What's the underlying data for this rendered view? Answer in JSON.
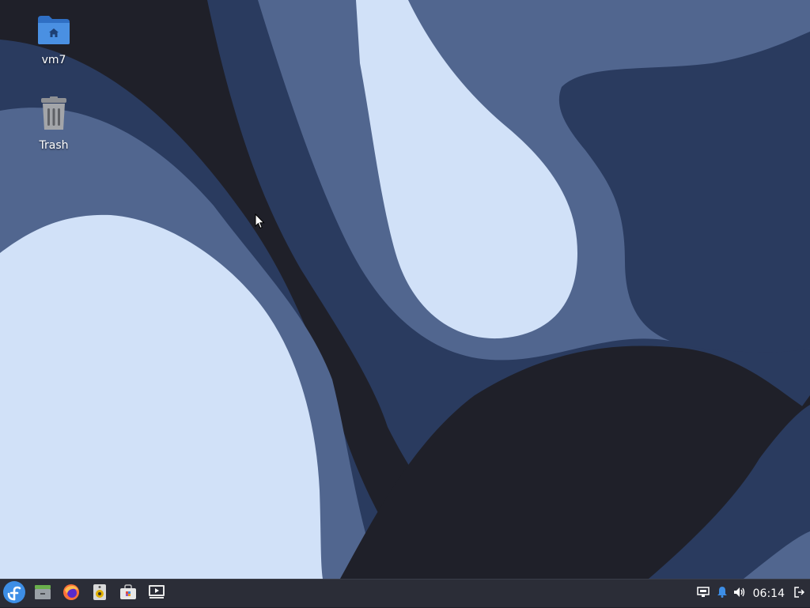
{
  "desktop": {
    "icons": [
      {
        "label": "vm7",
        "icon": "home-folder-icon"
      },
      {
        "label": "Trash",
        "icon": "trash-icon"
      }
    ]
  },
  "taskbar": {
    "launchers": [
      {
        "name": "start-menu",
        "icon": "fedora-logo-icon"
      },
      {
        "name": "file-manager",
        "icon": "file-cabinet-icon"
      },
      {
        "name": "firefox",
        "icon": "firefox-icon"
      },
      {
        "name": "audio-player",
        "icon": "speaker-app-icon"
      },
      {
        "name": "software-center",
        "icon": "software-bag-icon"
      },
      {
        "name": "media-player",
        "icon": "video-player-icon"
      }
    ],
    "tray": {
      "network_icon": "network-wired-icon",
      "notifications_icon": "bell-icon",
      "volume_icon": "volume-icon",
      "clock": "06:14",
      "logout_icon": "logout-icon"
    }
  },
  "colors": {
    "wallpaper_dark": "#1f2029",
    "wallpaper_navy": "#2a3b5f",
    "wallpaper_mid": "#51668f",
    "wallpaper_light": "#d1e1f8",
    "taskbar_bg": "#2b2d37",
    "accent_blue": "#3d8ee6"
  }
}
